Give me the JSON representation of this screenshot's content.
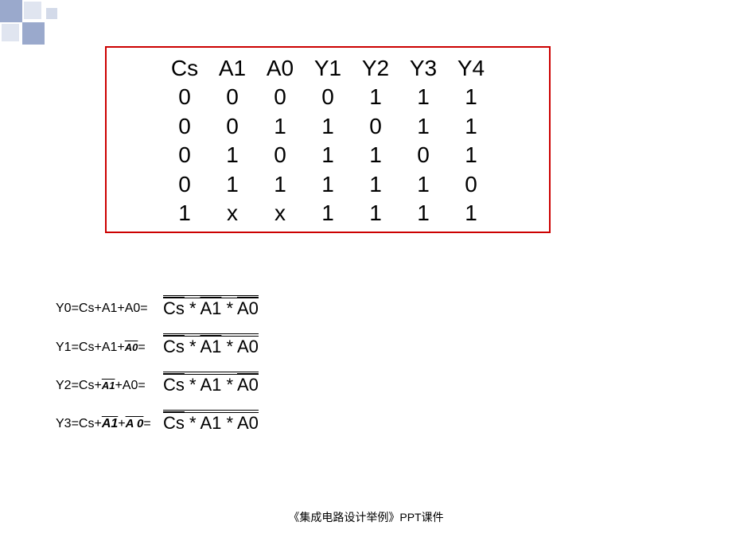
{
  "chart_data": {
    "type": "table",
    "headers": [
      "Cs",
      "A1",
      "A0",
      "Y1",
      "Y2",
      "Y3",
      "Y4"
    ],
    "rows": [
      [
        "0",
        "0",
        "0",
        "0",
        "1",
        "1",
        "1"
      ],
      [
        "0",
        "0",
        "1",
        "1",
        "0",
        "1",
        "1"
      ],
      [
        "0",
        "1",
        "0",
        "1",
        "1",
        "0",
        "1"
      ],
      [
        "0",
        "1",
        "1",
        "1",
        "1",
        "1",
        "0"
      ],
      [
        "1",
        "x",
        "x",
        "1",
        "1",
        "1",
        "1"
      ]
    ]
  },
  "table": {
    "h0": "Cs",
    "h1": "A1",
    "h2": "A0",
    "h3": "Y1",
    "h4": "Y2",
    "h5": "Y3",
    "h6": "Y4",
    "r0c0": "0",
    "r0c1": "0",
    "r0c2": "0",
    "r0c3": "0",
    "r0c4": "1",
    "r0c5": "1",
    "r0c6": "1",
    "r1c0": "0",
    "r1c1": "0",
    "r1c2": "1",
    "r1c3": "1",
    "r1c4": "0",
    "r1c5": "1",
    "r1c6": "1",
    "r2c0": "0",
    "r2c1": "1",
    "r2c2": "0",
    "r2c3": "1",
    "r2c4": "1",
    "r2c5": "0",
    "r2c6": "1",
    "r3c0": "0",
    "r3c1": "1",
    "r3c2": "1",
    "r3c3": "1",
    "r3c4": "1",
    "r3c5": "1",
    "r3c6": "0",
    "r4c0": "1",
    "r4c1": "x",
    "r4c2": "x",
    "r4c3": "1",
    "r4c4": "1",
    "r4c5": "1",
    "r4c6": "1"
  },
  "eq": {
    "y0_left": "Y0=Cs+A1+A0=",
    "y1_left_a": "Y1=Cs+A1+",
    "y1_left_b": "A0",
    "y1_left_c": " =",
    "y2_left_a": "Y2=Cs+ ",
    "y2_left_b": "A1",
    "y2_left_c": " +A0=",
    "y3_left_a": "Y3=Cs+ ",
    "y3_left_b": "A1",
    "y3_left_c": " + ",
    "y3_left_d": "A 0",
    "y3_left_e": " =",
    "term_cs": "Cs",
    "term_a1": "A1",
    "term_a0": "A0",
    "star": "  *  "
  },
  "footer": "《集成电路设计举例》PPT课件"
}
